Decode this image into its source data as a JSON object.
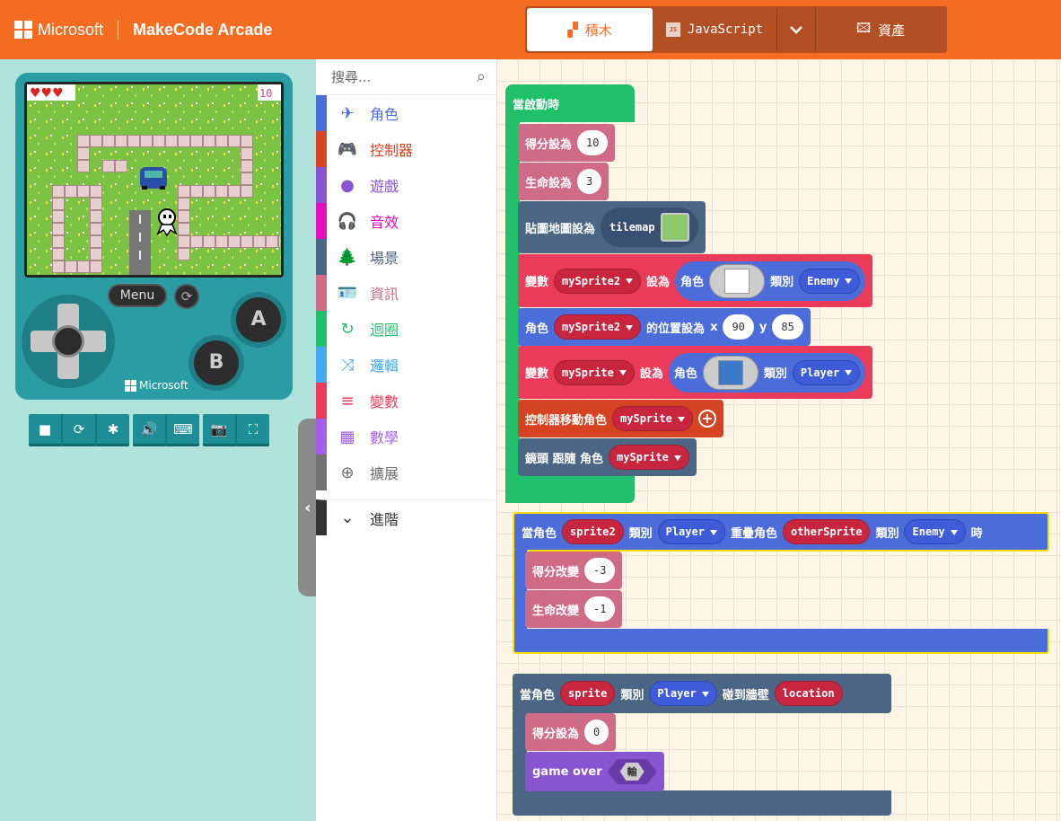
{
  "header": {
    "ms_label": "Microsoft",
    "app_title": "MakeCode Arcade",
    "tabs": {
      "blocks": "積木",
      "javascript": "JavaScript",
      "assets": "資產"
    }
  },
  "simulator": {
    "menu_label": "Menu",
    "a_label": "A",
    "b_label": "B",
    "ms_label": "Microsoft",
    "score_display": "10",
    "lives_display": 3,
    "toolbar_icons": [
      "stop-icon",
      "restart-icon",
      "debug-icon",
      "sound-icon",
      "keyboard-icon",
      "screenshot-icon",
      "fullscreen-icon"
    ]
  },
  "toolbox": {
    "search_placeholder": "搜尋...",
    "categories": [
      {
        "label": "角色",
        "color": "#4b6cd9",
        "icon": "✈"
      },
      {
        "label": "控制器",
        "color": "#d54322",
        "icon": "🎮"
      },
      {
        "label": "遊戲",
        "color": "#8854d0",
        "icon": "●"
      },
      {
        "label": "音效",
        "color": "#e30fc0",
        "icon": "🎧"
      },
      {
        "label": "場景",
        "color": "#4b6584",
        "icon": "🌲"
      },
      {
        "label": "資訊",
        "color": "#cf6a87",
        "icon": "🪪"
      },
      {
        "label": "迴圈",
        "color": "#20bf6b",
        "icon": "↻"
      },
      {
        "label": "邏輯",
        "color": "#45aaf2",
        "icon": "⤨"
      },
      {
        "label": "變數",
        "color": "#eb3b5a",
        "icon": "≡"
      },
      {
        "label": "數學",
        "color": "#a55eea",
        "icon": "▦"
      },
      {
        "label": "擴展",
        "color": "#717171",
        "icon": "⊕"
      },
      {
        "label": "進階",
        "color": "#333333",
        "icon": "⌄"
      }
    ]
  },
  "blocks": {
    "on_start": "當啟動時",
    "set_score": "得分設為",
    "score_val": "10",
    "set_life": "生命設為",
    "life_val": "3",
    "set_tilemap": "貼圖地圖設為",
    "tilemap": "tilemap",
    "var_label": "變數",
    "sprite2": "mySprite2",
    "set_to": "設為",
    "sprite_kw": "角色",
    "kind_kw": "類別",
    "enemy": "Enemy",
    "sprite_kw2": "角色",
    "pos_label": "的位置設為",
    "x_label": "x",
    "x_val": "90",
    "y_label": "y",
    "y_val": "85",
    "var_label2": "變數",
    "sprite1": "mySprite",
    "set_to2": "設為",
    "sprite_kw3": "角色",
    "kind_kw2": "類別",
    "player": "Player",
    "move_label": "控制器移動角色",
    "move_sprite": "mySprite",
    "camera_label": "鏡頭 跟隨 角色",
    "camera_sprite": "mySprite",
    "overlap_on": "當角色",
    "overlap_s2": "sprite2",
    "overlap_kind": "類別",
    "overlap_player": "Player",
    "overlap_with": "重疊角色",
    "overlap_other": "otherSprite",
    "overlap_kind2": "類別",
    "overlap_enemy": "Enemy",
    "overlap_when": "時",
    "change_score": "得分改變",
    "change_score_val": "-3",
    "change_life": "生命改變",
    "change_life_val": "-1",
    "wall_on": "當角色",
    "wall_sprite": "sprite",
    "wall_kind": "類別",
    "wall_player": "Player",
    "wall_hit": "碰到牆壁",
    "wall_loc": "location",
    "set_score2": "得分設為",
    "set_score2_val": "0",
    "game_over": "game over",
    "lose": "輸"
  }
}
